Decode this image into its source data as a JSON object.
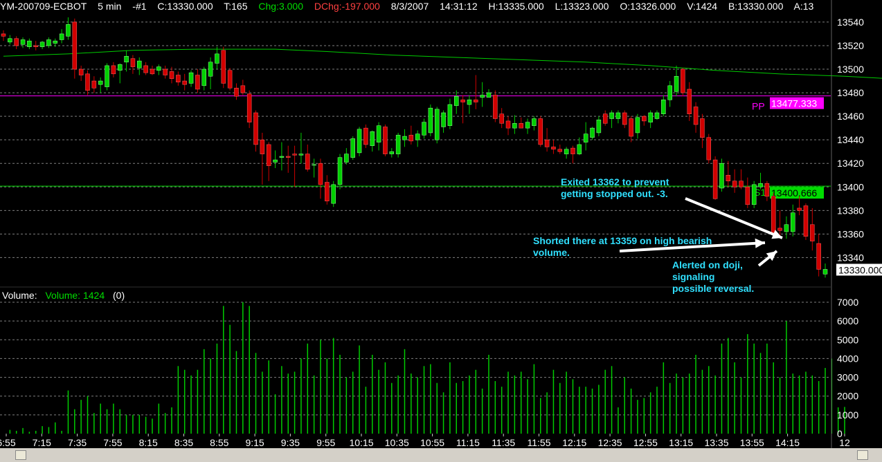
{
  "header": {
    "symbol": "YM-200709-ECBOT",
    "interval": "5 min",
    "chart_no": "-#1",
    "close": "C:13330.000",
    "ticks": "T:165",
    "change": "Chg:3.000",
    "daily_change": "DChg:-197.000",
    "date": "8/3/2007",
    "time": "14:31:12",
    "high": "H:13335.000",
    "low": "L:13323.000",
    "open": "O:13326.000",
    "volume": "V:1424",
    "bid": "B:13330.000",
    "ask": "A:13"
  },
  "colors": {
    "background": "#000000",
    "up_candle": "#00d000",
    "down_candle": "#d00000",
    "moving_average": "#00cc00",
    "pivot": "#ff00ff",
    "support": "#00dd00",
    "volume_bar": "#00cc00",
    "annotation": "#30e0ff",
    "change_text": "#00dd00",
    "daily_change_text": "#ff4040"
  },
  "volume_panel": {
    "label": "Volume:",
    "series_label": "Volume: 1424",
    "extra": "(0)"
  },
  "annotations": [
    "Exited 13362 to prevent getting stopped out.  -3.",
    "Shorted there at 13359 on high bearish volume.",
    "Alerted on doji, signaling possible reversal."
  ],
  "chart_data": [
    {
      "type": "candlestick",
      "title": "YM-200709-ECBOT 5 min",
      "price_ylim": [
        13315,
        13547
      ],
      "y_ticks": [
        13540,
        13520,
        13500,
        13480,
        13460,
        13440,
        13420,
        13400,
        13380,
        13360,
        13340
      ],
      "x_ticks": [
        "6:55",
        "7:15",
        "7:35",
        "7:55",
        "8:15",
        "8:35",
        "8:55",
        "9:15",
        "9:35",
        "9:55",
        "10:15",
        "10:35",
        "10:55",
        "11:15",
        "11:35",
        "11:55",
        "12:15",
        "12:35",
        "12:55",
        "13:15",
        "13:35",
        "13:55",
        "14:15",
        "12"
      ],
      "last_price": "13330.000",
      "pivot": {
        "label": "PP",
        "value": 13477.333,
        "text": "13477.333"
      },
      "support": {
        "label": "S1",
        "value": 13400.666,
        "text": "13400.666"
      },
      "moving_average": [
        {
          "bar": 0,
          "value": 13511
        },
        {
          "bar": 10,
          "value": 13513
        },
        {
          "bar": 20,
          "value": 13516
        },
        {
          "bar": 30,
          "value": 13517
        },
        {
          "bar": 42,
          "value": 13517
        },
        {
          "bar": 50,
          "value": 13515
        },
        {
          "bar": 60,
          "value": 13512
        },
        {
          "bar": 70,
          "value": 13510
        },
        {
          "bar": 80,
          "value": 13508
        },
        {
          "bar": 90,
          "value": 13506
        },
        {
          "bar": 100,
          "value": 13503
        },
        {
          "bar": 110,
          "value": 13499
        },
        {
          "bar": 120,
          "value": 13496
        },
        {
          "bar": 130,
          "value": 13494
        },
        {
          "bar": 140,
          "value": 13491
        },
        {
          "bar": 150,
          "value": 13488
        },
        {
          "bar": 160,
          "value": 13485
        }
      ],
      "candles": [
        {
          "o": 13530,
          "h": 13533,
          "l": 13524,
          "c": 13528
        },
        {
          "o": 13523,
          "h": 13529,
          "l": 13521,
          "c": 13526
        },
        {
          "o": 13526,
          "h": 13528,
          "l": 13517,
          "c": 13520
        },
        {
          "o": 13521,
          "h": 13527,
          "l": 13518,
          "c": 13525
        },
        {
          "o": 13519,
          "h": 13526,
          "l": 13517,
          "c": 13524
        },
        {
          "o": 13520,
          "h": 13524,
          "l": 13516,
          "c": 13519
        },
        {
          "o": 13519,
          "h": 13524,
          "l": 13517,
          "c": 13523
        },
        {
          "o": 13520,
          "h": 13527,
          "l": 13518,
          "c": 13525
        },
        {
          "o": 13522,
          "h": 13526,
          "l": 13519,
          "c": 13524
        },
        {
          "o": 13525,
          "h": 13534,
          "l": 13522,
          "c": 13530
        },
        {
          "o": 13528,
          "h": 13544,
          "l": 13525,
          "c": 13538
        },
        {
          "o": 13540,
          "h": 13543,
          "l": 13492,
          "c": 13500
        },
        {
          "o": 13500,
          "h": 13503,
          "l": 13490,
          "c": 13495
        },
        {
          "o": 13496,
          "h": 13499,
          "l": 13478,
          "c": 13482
        },
        {
          "o": 13490,
          "h": 13494,
          "l": 13480,
          "c": 13484
        },
        {
          "o": 13487,
          "h": 13493,
          "l": 13480,
          "c": 13490
        },
        {
          "o": 13485,
          "h": 13505,
          "l": 13482,
          "c": 13503
        },
        {
          "o": 13503,
          "h": 13506,
          "l": 13493,
          "c": 13496
        },
        {
          "o": 13499,
          "h": 13505,
          "l": 13488,
          "c": 13504
        },
        {
          "o": 13506,
          "h": 13516,
          "l": 13498,
          "c": 13511
        },
        {
          "o": 13509,
          "h": 13512,
          "l": 13496,
          "c": 13502
        },
        {
          "o": 13501,
          "h": 13510,
          "l": 13495,
          "c": 13507
        },
        {
          "o": 13503,
          "h": 13506,
          "l": 13495,
          "c": 13497
        },
        {
          "o": 13500,
          "h": 13503,
          "l": 13495,
          "c": 13496
        },
        {
          "o": 13499,
          "h": 13504,
          "l": 13495,
          "c": 13502
        },
        {
          "o": 13500,
          "h": 13503,
          "l": 13492,
          "c": 13495
        },
        {
          "o": 13498,
          "h": 13502,
          "l": 13488,
          "c": 13492
        },
        {
          "o": 13495,
          "h": 13498,
          "l": 13486,
          "c": 13489
        },
        {
          "o": 13490,
          "h": 13496,
          "l": 13482,
          "c": 13487
        },
        {
          "o": 13488,
          "h": 13499,
          "l": 13485,
          "c": 13497
        },
        {
          "o": 13495,
          "h": 13500,
          "l": 13480,
          "c": 13483
        },
        {
          "o": 13486,
          "h": 13502,
          "l": 13482,
          "c": 13500
        },
        {
          "o": 13494,
          "h": 13510,
          "l": 13483,
          "c": 13506
        },
        {
          "o": 13505,
          "h": 13519,
          "l": 13500,
          "c": 13513
        },
        {
          "o": 13516,
          "h": 13519,
          "l": 13484,
          "c": 13488
        },
        {
          "o": 13499,
          "h": 13501,
          "l": 13482,
          "c": 13484
        },
        {
          "o": 13484,
          "h": 13488,
          "l": 13474,
          "c": 13477
        },
        {
          "o": 13486,
          "h": 13491,
          "l": 13478,
          "c": 13480
        },
        {
          "o": 13479,
          "h": 13482,
          "l": 13450,
          "c": 13455
        },
        {
          "o": 13463,
          "h": 13465,
          "l": 13430,
          "c": 13436
        },
        {
          "o": 13440,
          "h": 13446,
          "l": 13402,
          "c": 13428
        },
        {
          "o": 13436,
          "h": 13438,
          "l": 13405,
          "c": 13418
        },
        {
          "o": 13421,
          "h": 13431,
          "l": 13416,
          "c": 13423
        },
        {
          "o": 13425,
          "h": 13438,
          "l": 13414,
          "c": 13426
        },
        {
          "o": 13426,
          "h": 13435,
          "l": 13412,
          "c": 13425
        },
        {
          "o": 13428,
          "h": 13435,
          "l": 13400,
          "c": 13427
        },
        {
          "o": 13427,
          "h": 13446,
          "l": 13420,
          "c": 13428
        },
        {
          "o": 13428,
          "h": 13436,
          "l": 13413,
          "c": 13415
        },
        {
          "o": 13419,
          "h": 13424,
          "l": 13408,
          "c": 13419
        },
        {
          "o": 13420,
          "h": 13424,
          "l": 13390,
          "c": 13402
        },
        {
          "o": 13404,
          "h": 13410,
          "l": 13385,
          "c": 13388
        },
        {
          "o": 13386,
          "h": 13405,
          "l": 13383,
          "c": 13402
        },
        {
          "o": 13402,
          "h": 13428,
          "l": 13398,
          "c": 13425
        },
        {
          "o": 13421,
          "h": 13433,
          "l": 13419,
          "c": 13428
        },
        {
          "o": 13425,
          "h": 13443,
          "l": 13423,
          "c": 13441
        },
        {
          "o": 13429,
          "h": 13451,
          "l": 13426,
          "c": 13449
        },
        {
          "o": 13450,
          "h": 13453,
          "l": 13433,
          "c": 13436
        },
        {
          "o": 13435,
          "h": 13448,
          "l": 13430,
          "c": 13447
        },
        {
          "o": 13438,
          "h": 13455,
          "l": 13431,
          "c": 13452
        },
        {
          "o": 13451,
          "h": 13453,
          "l": 13426,
          "c": 13428
        },
        {
          "o": 13428,
          "h": 13433,
          "l": 13425,
          "c": 13430
        },
        {
          "o": 13428,
          "h": 13446,
          "l": 13425,
          "c": 13444
        },
        {
          "o": 13440,
          "h": 13449,
          "l": 13434,
          "c": 13443
        },
        {
          "o": 13444,
          "h": 13452,
          "l": 13436,
          "c": 13439
        },
        {
          "o": 13440,
          "h": 13448,
          "l": 13434,
          "c": 13445
        },
        {
          "o": 13444,
          "h": 13458,
          "l": 13441,
          "c": 13455
        },
        {
          "o": 13446,
          "h": 13470,
          "l": 13443,
          "c": 13467
        },
        {
          "o": 13440,
          "h": 13468,
          "l": 13437,
          "c": 13466
        },
        {
          "o": 13451,
          "h": 13465,
          "l": 13446,
          "c": 13463
        },
        {
          "o": 13452,
          "h": 13475,
          "l": 13449,
          "c": 13470
        },
        {
          "o": 13469,
          "h": 13482,
          "l": 13462,
          "c": 13477
        },
        {
          "o": 13474,
          "h": 13478,
          "l": 13454,
          "c": 13472
        },
        {
          "o": 13470,
          "h": 13478,
          "l": 13462,
          "c": 13474
        },
        {
          "o": 13474,
          "h": 13495,
          "l": 13466,
          "c": 13472
        },
        {
          "o": 13476,
          "h": 13489,
          "l": 13468,
          "c": 13478
        },
        {
          "o": 13476,
          "h": 13483,
          "l": 13476,
          "c": 13480
        },
        {
          "o": 13478,
          "h": 13482,
          "l": 13455,
          "c": 13458
        },
        {
          "o": 13462,
          "h": 13467,
          "l": 13450,
          "c": 13454
        },
        {
          "o": 13456,
          "h": 13460,
          "l": 13444,
          "c": 13450
        },
        {
          "o": 13450,
          "h": 13461,
          "l": 13445,
          "c": 13454
        },
        {
          "o": 13454,
          "h": 13459,
          "l": 13450,
          "c": 13450
        },
        {
          "o": 13450,
          "h": 13458,
          "l": 13445,
          "c": 13455
        },
        {
          "o": 13452,
          "h": 13460,
          "l": 13448,
          "c": 13458
        },
        {
          "o": 13458,
          "h": 13460,
          "l": 13434,
          "c": 13436
        },
        {
          "o": 13440,
          "h": 13450,
          "l": 13430,
          "c": 13434
        },
        {
          "o": 13434,
          "h": 13440,
          "l": 13428,
          "c": 13432
        },
        {
          "o": 13432,
          "h": 13436,
          "l": 13428,
          "c": 13430
        },
        {
          "o": 13428,
          "h": 13434,
          "l": 13424,
          "c": 13432
        },
        {
          "o": 13433,
          "h": 13435,
          "l": 13420,
          "c": 13428
        },
        {
          "o": 13428,
          "h": 13442,
          "l": 13427,
          "c": 13436
        },
        {
          "o": 13438,
          "h": 13455,
          "l": 13431,
          "c": 13445
        },
        {
          "o": 13442,
          "h": 13451,
          "l": 13440,
          "c": 13450
        },
        {
          "o": 13446,
          "h": 13460,
          "l": 13443,
          "c": 13457
        },
        {
          "o": 13462,
          "h": 13465,
          "l": 13452,
          "c": 13454
        },
        {
          "o": 13458,
          "h": 13465,
          "l": 13450,
          "c": 13463
        },
        {
          "o": 13458,
          "h": 13465,
          "l": 13454,
          "c": 13463
        },
        {
          "o": 13463,
          "h": 13465,
          "l": 13450,
          "c": 13453
        },
        {
          "o": 13458,
          "h": 13460,
          "l": 13438,
          "c": 13443
        },
        {
          "o": 13446,
          "h": 13462,
          "l": 13441,
          "c": 13459
        },
        {
          "o": 13460,
          "h": 13461,
          "l": 13452,
          "c": 13456
        },
        {
          "o": 13455,
          "h": 13465,
          "l": 13450,
          "c": 13463
        },
        {
          "o": 13458,
          "h": 13465,
          "l": 13457,
          "c": 13463
        },
        {
          "o": 13462,
          "h": 13478,
          "l": 13460,
          "c": 13474
        },
        {
          "o": 13474,
          "h": 13490,
          "l": 13468,
          "c": 13486
        },
        {
          "o": 13481,
          "h": 13503,
          "l": 13477,
          "c": 13494
        },
        {
          "o": 13500,
          "h": 13501,
          "l": 13477,
          "c": 13480
        },
        {
          "o": 13483,
          "h": 13489,
          "l": 13456,
          "c": 13462
        },
        {
          "o": 13468,
          "h": 13472,
          "l": 13446,
          "c": 13453
        },
        {
          "o": 13458,
          "h": 13462,
          "l": 13433,
          "c": 13442
        },
        {
          "o": 13442,
          "h": 13445,
          "l": 13420,
          "c": 13423
        },
        {
          "o": 13423,
          "h": 13426,
          "l": 13389,
          "c": 13390
        },
        {
          "o": 13399,
          "h": 13424,
          "l": 13396,
          "c": 13420
        },
        {
          "o": 13410,
          "h": 13422,
          "l": 13400,
          "c": 13405
        },
        {
          "o": 13405,
          "h": 13415,
          "l": 13395,
          "c": 13400
        },
        {
          "o": 13405,
          "h": 13415,
          "l": 13398,
          "c": 13400
        },
        {
          "o": 13400,
          "h": 13408,
          "l": 13382,
          "c": 13385
        },
        {
          "o": 13385,
          "h": 13405,
          "l": 13382,
          "c": 13402
        },
        {
          "o": 13400,
          "h": 13412,
          "l": 13398,
          "c": 13403
        },
        {
          "o": 13403,
          "h": 13405,
          "l": 13388,
          "c": 13392
        },
        {
          "o": 13392,
          "h": 13395,
          "l": 13366,
          "c": 13360
        },
        {
          "o": 13365,
          "h": 13380,
          "l": 13358,
          "c": 13363
        },
        {
          "o": 13362,
          "h": 13375,
          "l": 13356,
          "c": 13368
        },
        {
          "o": 13362,
          "h": 13385,
          "l": 13358,
          "c": 13378
        },
        {
          "o": 13382,
          "h": 13392,
          "l": 13376,
          "c": 13380
        },
        {
          "o": 13384,
          "h": 13386,
          "l": 13355,
          "c": 13358
        },
        {
          "o": 13368,
          "h": 13382,
          "l": 13346,
          "c": 13354
        },
        {
          "o": 13352,
          "h": 13360,
          "l": 13324,
          "c": 13330
        },
        {
          "o": 13326,
          "h": 13335,
          "l": 13323,
          "c": 13330
        }
      ]
    },
    {
      "type": "bar",
      "title": "Volume",
      "ylim": [
        0,
        7500
      ],
      "y_ticks": [
        7000,
        6000,
        5000,
        4000,
        3000,
        2000,
        1000,
        0
      ],
      "values": [
        0,
        200,
        150,
        300,
        100,
        150,
        400,
        350,
        600,
        150,
        2300,
        1300,
        1800,
        2000,
        1100,
        1600,
        1300,
        1600,
        1300,
        1000,
        1000,
        1000,
        900,
        800,
        1600,
        1100,
        1400,
        3600,
        3400,
        3100,
        3400,
        4500,
        4000,
        4800,
        6800,
        5800,
        4400,
        7000,
        6800,
        4300,
        3300,
        3900,
        2100,
        3600,
        3200,
        3300,
        4000,
        4800,
        3100,
        5000,
        4000,
        5100,
        4200,
        3000,
        3300,
        4700,
        2500,
        4200,
        3400,
        3800,
        2700,
        3100,
        4500,
        3200,
        3000,
        3600,
        3700,
        2700,
        2200,
        3800,
        2700,
        2800,
        3100,
        3400,
        2400,
        4200,
        2800,
        2500,
        3300,
        3100,
        3300,
        2900,
        3700,
        1900,
        2200,
        3400,
        2700,
        3300,
        2900,
        2500,
        2500,
        2400,
        2600,
        3400,
        3600,
        1400,
        3000,
        2400,
        1800,
        1900,
        2200,
        2500,
        3800,
        2700,
        3200,
        3000,
        3200,
        4200,
        3400,
        3600,
        3100,
        4800,
        5100,
        3800,
        3000,
        5300,
        4800,
        4300,
        4800,
        3800,
        3000,
        6000,
        3200,
        3100,
        3300,
        3100,
        2800,
        3500,
        4000,
        1400,
        1424
      ]
    }
  ]
}
